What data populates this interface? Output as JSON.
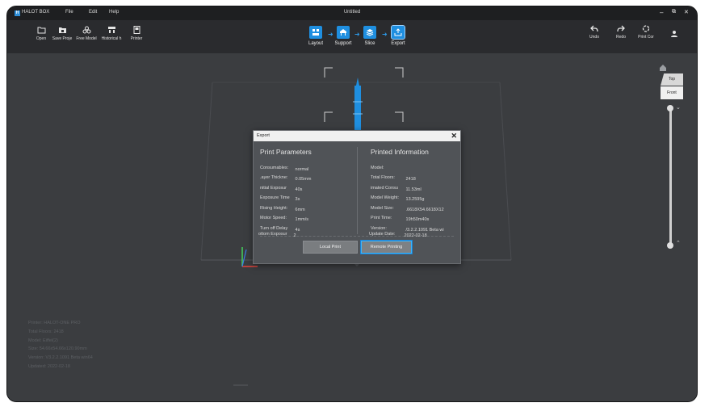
{
  "titlebar": {
    "app_name": "HALOT BOX",
    "logo_letter": "H",
    "menu": [
      "File",
      "Edit",
      "Help"
    ],
    "window_title": "Untitled",
    "controls": [
      "‒",
      "⧉",
      "✕"
    ]
  },
  "toolbar": {
    "left_tools": [
      {
        "label": "Open",
        "icon": "folder-open-icon"
      },
      {
        "label": "Save Proje",
        "icon": "folder-save-icon"
      },
      {
        "label": "Free Model",
        "icon": "models-icon"
      },
      {
        "label": "Historical h",
        "icon": "history-icon"
      },
      {
        "label": "Printer",
        "icon": "printer-icon"
      }
    ],
    "steps": [
      {
        "label": "Layout",
        "icon": "layout-icon"
      },
      {
        "label": "Support",
        "icon": "support-icon"
      },
      {
        "label": "Slice",
        "icon": "slice-icon"
      },
      {
        "label": "Export",
        "icon": "export-icon"
      }
    ],
    "right_tools": [
      {
        "label": "Undo",
        "icon": "undo-icon"
      },
      {
        "label": "Redo",
        "icon": "redo-icon"
      },
      {
        "label": "Print Cor",
        "icon": "print-control-icon"
      },
      {
        "label": "",
        "icon": "user-icon"
      }
    ]
  },
  "viewcube": {
    "top": "Top",
    "front": "Front"
  },
  "info_panel": [
    "Printer: HALOT-ONE PRO",
    "Total Floors: 2418",
    "Model: Eiffel(2)",
    "Size: 54.66x54.66x120.90mm",
    "Version: V3.2.2.1091 Beta win64",
    "Updated:  2022-02-18"
  ],
  "dialog": {
    "title": "Export",
    "close": "✕",
    "left_heading": "Print Parameters",
    "right_heading": "Printed Information",
    "left_rows": [
      {
        "key": "Consumables:",
        "value": "normal"
      },
      {
        "key": ".ayer Thickne:",
        "value": "0.05mm"
      },
      {
        "key": "nitial Exposur",
        "value": "40s"
      },
      {
        "key": "Exposure Time",
        "value": "3s"
      },
      {
        "key": "Rising Height:",
        "value": "6mm"
      },
      {
        "key": "Motor Speed:",
        "value": "1mm/s"
      },
      {
        "key": "Turn off Delay",
        "value": "4s"
      },
      {
        "key": "ottom Exposur",
        "value": "2"
      }
    ],
    "right_rows": [
      {
        "key": "Model:",
        "value": ""
      },
      {
        "key": "Total Floors:",
        "value": "2418"
      },
      {
        "key": "imated Consu",
        "value": "11.53ml"
      },
      {
        "key": "Model Weight:",
        "value": "13.2595g"
      },
      {
        "key": "Model Size:",
        "value": ".6618X54.6618X12"
      },
      {
        "key": "Print Time:",
        "value": "19h50m40s"
      },
      {
        "key": "Version:",
        "value": "/3.2.2.1091 Beta wi"
      },
      {
        "key": "Update Date:",
        "value": "2022-02-18"
      }
    ],
    "local_print": "Local Print",
    "remote_print": "Remote Printing"
  },
  "colors": {
    "accent": "#1f8fe0",
    "background": "#3b3d40",
    "toolbar": "#2a2b2e",
    "titlebar": "#1e1f21",
    "dialog": "#505357"
  }
}
